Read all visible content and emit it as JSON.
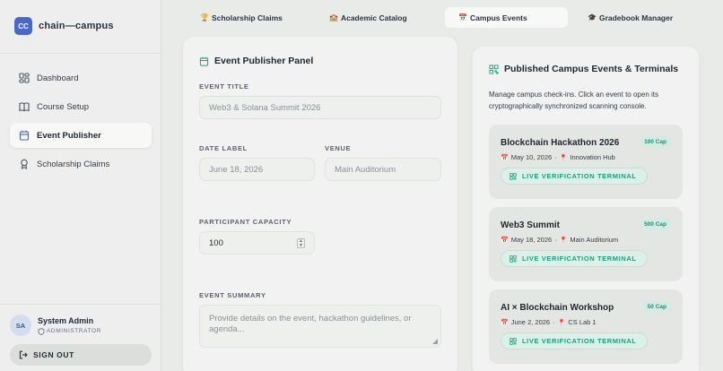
{
  "brand": {
    "logo_text": "CC",
    "name": "chain—campus"
  },
  "sidebar": {
    "items": [
      {
        "label": "Dashboard",
        "icon": "dashboard-icon"
      },
      {
        "label": "Course Setup",
        "icon": "book-icon"
      },
      {
        "label": "Event Publisher",
        "icon": "calendar-icon"
      },
      {
        "label": "Scholarship Claims",
        "icon": "award-icon"
      }
    ],
    "active_index": 2
  },
  "user": {
    "initials": "SA",
    "name": "System Admin",
    "role": "ADMINISTRATOR"
  },
  "signout_label": "SIGN OUT",
  "tabs": [
    {
      "icon": "🏆",
      "label": "Scholarship Claims"
    },
    {
      "icon": "🏫",
      "label": "Academic Catalog"
    },
    {
      "icon": "📅",
      "label": "Campus Events"
    },
    {
      "icon": "🎓",
      "label": "Gradebook Manager"
    }
  ],
  "active_tab": 2,
  "publisher": {
    "title": "Event Publisher Panel",
    "event_title_label": "EVENT TITLE",
    "event_title_placeholder": "Web3 & Solana Summit 2026",
    "date_label": "DATE LABEL",
    "date_placeholder": "June 18, 2026",
    "venue_label": "VENUE",
    "venue_placeholder": "Main Auditorium",
    "capacity_label": "PARTICIPANT CAPACITY",
    "capacity_value": "100",
    "summary_label": "EVENT SUMMARY",
    "summary_placeholder": "Provide details on the event, hackathon guidelines, or agenda..."
  },
  "events_panel": {
    "title": "Published Campus Events & Terminals",
    "description": "Manage campus check-ins. Click an event to open its cryptographically synchronized scanning console.",
    "button_label": "LIVE VERIFICATION TERMINAL",
    "events": [
      {
        "name": "Blockchain Hackathon 2026",
        "capacity": "100 Cap",
        "date": "May 10, 2026",
        "venue": "Innovation Hub"
      },
      {
        "name": "Web3 Summit",
        "capacity": "500 Cap",
        "date": "May 18, 2026",
        "venue": "Main Auditorium"
      },
      {
        "name": "AI × Blockchain Workshop",
        "capacity": "50 Cap",
        "date": "June 2, 2026",
        "venue": "CS Lab 1"
      }
    ]
  },
  "colors": {
    "accent": "#4a67c9",
    "teal": "#1f9c80",
    "teal_bg": "#dcefe8"
  }
}
